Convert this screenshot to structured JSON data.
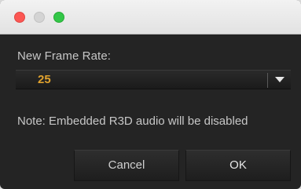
{
  "window": {
    "traffic_lights": [
      "close",
      "minimize",
      "maximize"
    ]
  },
  "form": {
    "frame_rate_label": "New Frame Rate:",
    "frame_rate_value": "25",
    "note": "Note: Embedded R3D audio will be disabled"
  },
  "buttons": {
    "cancel_label": "Cancel",
    "ok_label": "OK"
  },
  "colors": {
    "accent": "#e0a22e",
    "close": "#fc5753",
    "maximize": "#33c748"
  }
}
